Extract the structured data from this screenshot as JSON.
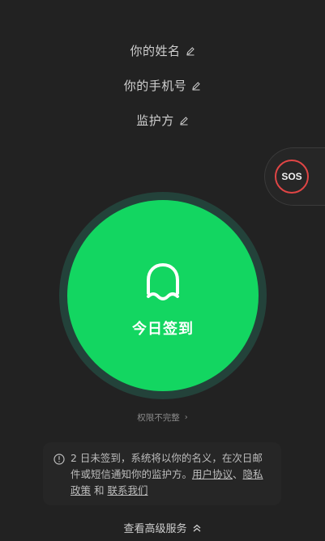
{
  "profile": {
    "name_label": "你的姓名",
    "phone_label": "你的手机号",
    "guardian_label": "监护方"
  },
  "sos": {
    "label": "SOS",
    "color": "#e04545"
  },
  "checkin": {
    "label": "今日签到",
    "icon": "ghost-icon",
    "color": "#13d661"
  },
  "permission": {
    "label": "权限不完整",
    "chevron": "›"
  },
  "notice": {
    "text_prefix": "2 日未签到，系统将以你的名义，在次日邮件或短信通知你的监护方。",
    "user_agreement": "用户协议",
    "separator": "、",
    "privacy_policy": "隐私政策",
    "and": " 和 ",
    "contact_us": "联系我们"
  },
  "more_services": {
    "label": "查看高级服务"
  }
}
